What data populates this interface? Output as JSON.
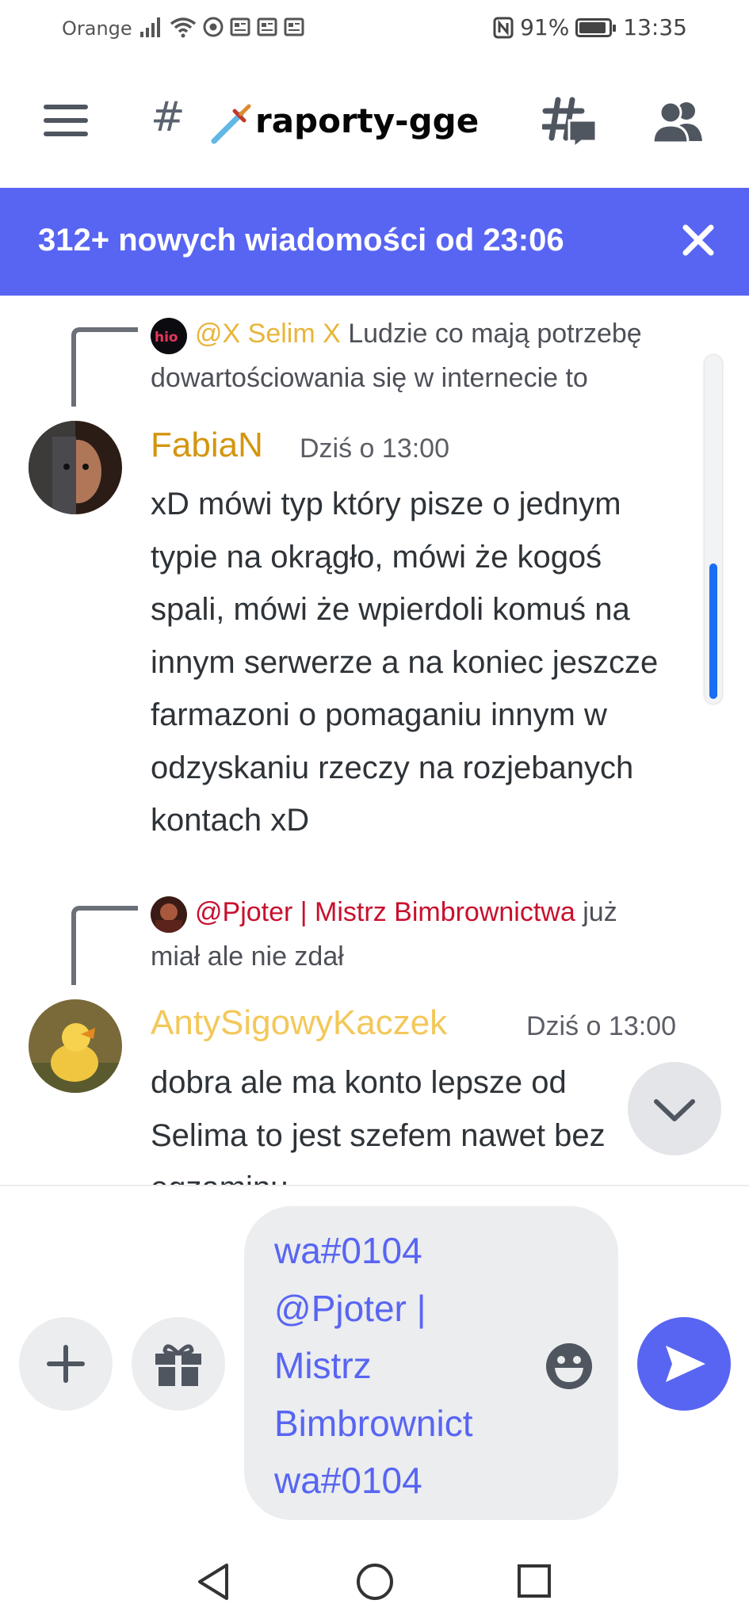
{
  "status_bar": {
    "carrier": "Orange",
    "battery_percent": "91%",
    "battery_level": 0.91,
    "time": "13:35",
    "icons": [
      "signal-icon",
      "wifi-icon",
      "chrome-icon",
      "news-icon",
      "news-icon",
      "news-icon",
      "nfc-icon",
      "battery-icon"
    ]
  },
  "header": {
    "hash": "#",
    "channel_name": "raporty-gge",
    "channel_emoji": "dagger-icon",
    "icons": [
      "hamburger-menu-icon",
      "threads-icon",
      "members-icon"
    ]
  },
  "banner": {
    "text": "312+ nowych wiadomości od 23:06",
    "color": "#5865f2",
    "close_icon": "close-icon"
  },
  "messages": [
    {
      "reply": {
        "mention": "@X Selim X",
        "mention_color": "#e8b53a",
        "text_line1": " Ludzie co mają potrzebę",
        "text_line2": "dowartościowania się w internecie to"
      },
      "author": "FabiaN",
      "author_color": "#d4960f",
      "timestamp": "Dziś o 13:00",
      "body": "xD mówi typ który pisze o jednym\ntypie na okrągło, mówi że kogoś\nspali, mówi że wpierdoli komuś na\ninnym serwerze a na koniec jeszcze\nfarmazoni o pomaganiu innym w\nodzyskaniu rzeczy na rozjebanych\nkontach xD"
    },
    {
      "reply": {
        "mention": "@Pjoter | Mistrz Bimbrownictwa",
        "mention_color": "#c8102e",
        "text_line1": " już",
        "text_line2": "miał ale nie zdał"
      },
      "author": "AntySigowyKaczek",
      "author_color": "#f3c85a",
      "timestamp": "Dziś o 13:00",
      "body": "dobra ale ma konto lepsze od\nSelima to jest szefem nawet bez\negzaminu"
    }
  ],
  "scroll": {
    "thumb_start": 0.6,
    "thumb_end": 1.0
  },
  "composer": {
    "text": "wa#0104\n@Pjoter |\nMistrz\nBimbrownict\nwa#0104",
    "text_color": "#5865f2",
    "buttons": [
      "plus-icon",
      "gift-icon",
      "emoji-icon",
      "send-icon"
    ]
  },
  "navbar": {
    "icons": [
      "back-icon",
      "home-icon",
      "recents-icon"
    ]
  }
}
